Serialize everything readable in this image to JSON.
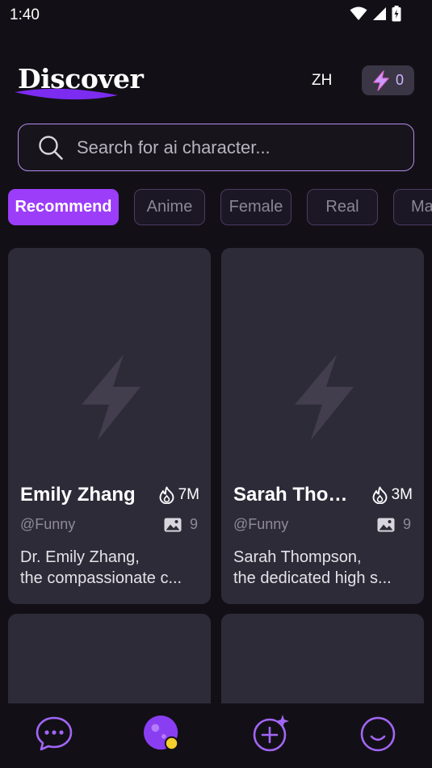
{
  "status": {
    "time": "1:40"
  },
  "header": {
    "title": "Discover",
    "language": "ZH",
    "energy_count": "0"
  },
  "search": {
    "placeholder": "Search for ai character..."
  },
  "tabs": [
    {
      "label": "Recommend",
      "active": true
    },
    {
      "label": "Anime",
      "active": false
    },
    {
      "label": "Female",
      "active": false
    },
    {
      "label": "Real",
      "active": false
    },
    {
      "label": "Ma",
      "active": false
    }
  ],
  "cards": [
    {
      "name": "Emily Zhang",
      "hot": "7M",
      "tag": "@Funny",
      "pics": "9",
      "desc_line1": "Dr. Emily Zhang,",
      "desc_line2": "the compassionate c..."
    },
    {
      "name": "Sarah Thompson",
      "hot": "3M",
      "tag": "@Funny",
      "pics": "9",
      "desc_line1": "Sarah Thompson,",
      "desc_line2": "the dedicated high s..."
    }
  ],
  "nav": [
    {
      "icon": "chat-icon",
      "active": false
    },
    {
      "icon": "discover-planet-icon",
      "active": true
    },
    {
      "icon": "create-plus-icon",
      "active": false
    },
    {
      "icon": "profile-smile-icon",
      "active": false
    }
  ],
  "colors": {
    "accent": "#9c3dfa",
    "card_bg": "#2e2b38",
    "background": "#121016",
    "outline": "#b48cf0"
  }
}
